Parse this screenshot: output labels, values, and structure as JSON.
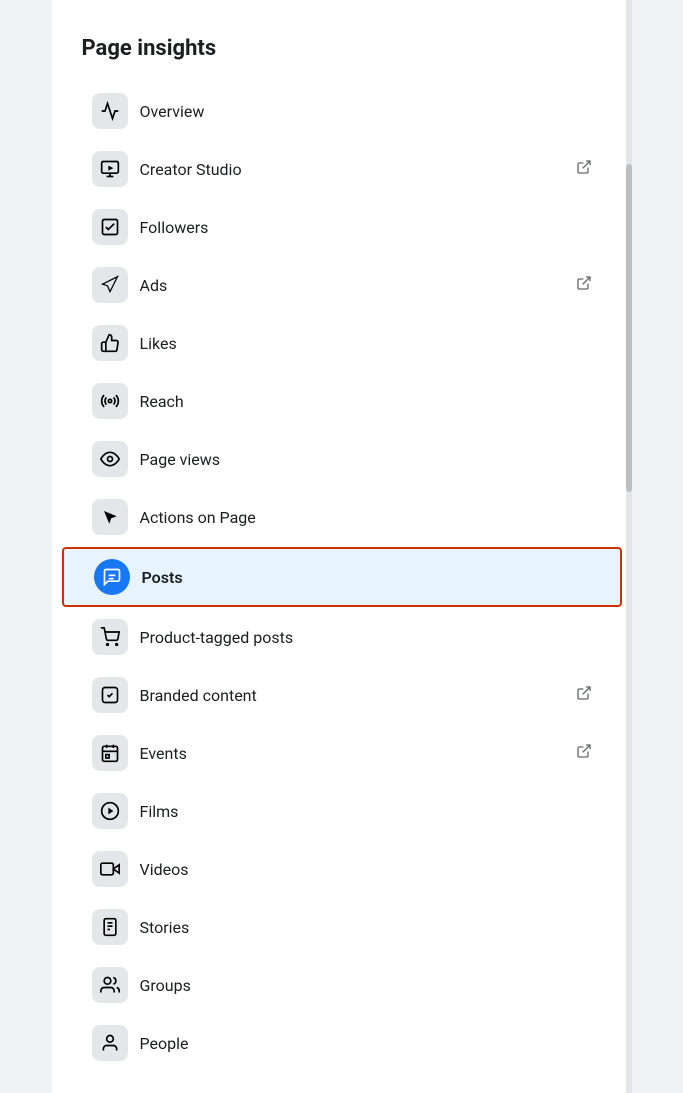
{
  "page": {
    "title": "Page insights"
  },
  "menu": {
    "items": [
      {
        "id": "overview",
        "label": "Overview",
        "icon": "📈",
        "external": false,
        "active": false,
        "unicode": "〜"
      },
      {
        "id": "creator-studio",
        "label": "Creator Studio",
        "icon": "🎬",
        "external": true,
        "active": false
      },
      {
        "id": "followers",
        "label": "Followers",
        "icon": "✔",
        "external": false,
        "active": false
      },
      {
        "id": "ads",
        "label": "Ads",
        "icon": "📢",
        "external": true,
        "active": false
      },
      {
        "id": "likes",
        "label": "Likes",
        "icon": "👍",
        "external": false,
        "active": false
      },
      {
        "id": "reach",
        "label": "Reach",
        "icon": "📡",
        "external": false,
        "active": false
      },
      {
        "id": "page-views",
        "label": "Page views",
        "icon": "👁",
        "external": false,
        "active": false
      },
      {
        "id": "actions-on-page",
        "label": "Actions on Page",
        "icon": "▶",
        "external": false,
        "active": false
      },
      {
        "id": "posts",
        "label": "Posts",
        "icon": "☰",
        "external": false,
        "active": true
      },
      {
        "id": "product-tagged",
        "label": "Product-tagged posts",
        "icon": "🛒",
        "external": false,
        "active": false
      },
      {
        "id": "branded-content",
        "label": "Branded content",
        "icon": "✅",
        "external": true,
        "active": false
      },
      {
        "id": "events",
        "label": "Events",
        "icon": "📅",
        "external": true,
        "active": false
      },
      {
        "id": "films",
        "label": "Films",
        "icon": "▶",
        "external": false,
        "active": false
      },
      {
        "id": "videos",
        "label": "Videos",
        "icon": "▶",
        "external": false,
        "active": false
      },
      {
        "id": "stories",
        "label": "Stories",
        "icon": "📖",
        "external": false,
        "active": false
      },
      {
        "id": "groups",
        "label": "Groups",
        "icon": "👥",
        "external": false,
        "active": false
      },
      {
        "id": "people",
        "label": "People",
        "icon": "👤",
        "external": false,
        "active": false
      }
    ]
  },
  "icons": {
    "overview": "⟨∿⟩",
    "external_link": "⊡"
  }
}
